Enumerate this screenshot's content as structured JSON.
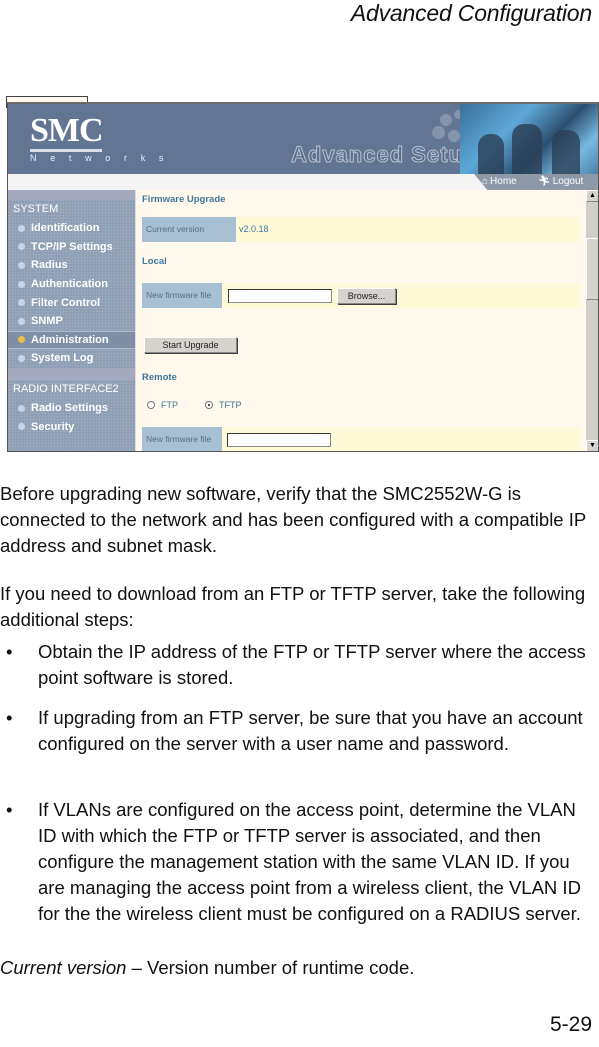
{
  "running_head": "Advanced Configuration",
  "page_number": "5-29",
  "screenshot": {
    "banner": {
      "logo_text": "SMC",
      "logo_subtext": "N e t w o r k s",
      "title": "Advanced Setup",
      "nav": [
        {
          "label": "Home",
          "icon": "home-icon"
        },
        {
          "label": "Logout",
          "icon": "logout-icon"
        }
      ]
    },
    "sidebar": {
      "sections": [
        {
          "title": "SYSTEM",
          "items": [
            {
              "label": "Identification",
              "active": false
            },
            {
              "label": "TCP/IP Settings",
              "active": false
            },
            {
              "label": "Radius",
              "active": false
            },
            {
              "label": "Authentication",
              "active": false
            },
            {
              "label": "Filter Control",
              "active": false
            },
            {
              "label": "SNMP",
              "active": false
            },
            {
              "label": "Administration",
              "active": true
            },
            {
              "label": "System Log",
              "active": false
            }
          ]
        },
        {
          "title": "RADIO INTERFACE2",
          "items": [
            {
              "label": "Radio Settings",
              "active": false
            },
            {
              "label": "Security",
              "active": false
            }
          ]
        }
      ]
    },
    "content": {
      "heading": "Firmware Upgrade",
      "current_version_label": "Current version",
      "current_version_value": "v2.0.18",
      "local_heading": "Local",
      "local_file_label": "New firmware file",
      "local_file_value": "",
      "browse_label": "Browse...",
      "start_upgrade_label": "Start Upgrade",
      "remote_heading": "Remote",
      "protocols": [
        {
          "label": "FTP",
          "selected": false
        },
        {
          "label": "TFTP",
          "selected": true
        }
      ],
      "remote_file_label": "New firmware file",
      "remote_file_value": ""
    }
  },
  "text": {
    "para1": "Before upgrading new software, verify that the SMC2552W-G is connected to the network and has been configured with a compatible IP address and subnet mask.",
    "para2": "If you need to download from an FTP or TFTP server, take the following additional steps:",
    "bullets": [
      "Obtain the IP address of the FTP or TFTP server where the access point software is stored.",
      "If upgrading from an FTP server, be sure that you have an account configured on the server with a user name and password.",
      "If VLANs are configured on the access point, determine the VLAN ID with which the FTP or TFTP server is associated, and then configure the management station with the same VLAN ID. If you are managing the access point from a wireless client, the VLAN ID for the the wireless client must be configured on a RADIUS server."
    ],
    "bullet_glyph": "•",
    "definition_term": "Current version",
    "definition_text": " – Version number of runtime code."
  }
}
